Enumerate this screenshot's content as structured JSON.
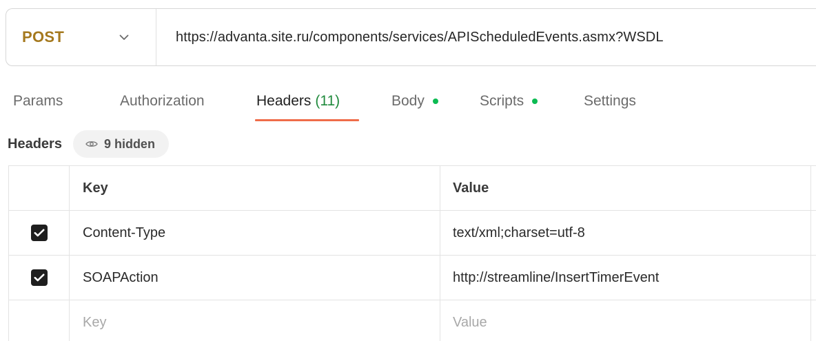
{
  "request": {
    "method": "POST",
    "url": "https://advanta.site.ru/components/services/APIScheduledEvents.asmx?WSDL"
  },
  "tabs": [
    {
      "label": "Params"
    },
    {
      "label": "Authorization"
    },
    {
      "label": "Headers",
      "count": "(11)",
      "active": true
    },
    {
      "label": "Body",
      "dot": true
    },
    {
      "label": "Scripts",
      "dot": true
    },
    {
      "label": "Settings"
    }
  ],
  "headers_section": {
    "title": "Headers",
    "hidden_label": "9 hidden"
  },
  "table": {
    "columns": {
      "key": "Key",
      "value": "Value"
    },
    "rows": [
      {
        "checked": true,
        "key": "Content-Type",
        "value": "text/xml;charset=utf-8"
      },
      {
        "checked": true,
        "key": "SOAPAction",
        "value": "http://streamline/InsertTimerEvent"
      }
    ],
    "placeholder": {
      "key": "Key",
      "value": "Value"
    }
  },
  "colors": {
    "method": "#a5791e",
    "active_tab_underline": "#ef6c4a",
    "status_dot": "#0cbb52",
    "checkbox": "#1e1e1e"
  },
  "icons": {
    "method_dropdown": "chevron-down-icon",
    "hidden_toggle": "eye-icon",
    "checkbox_mark": "checkmark-icon"
  }
}
